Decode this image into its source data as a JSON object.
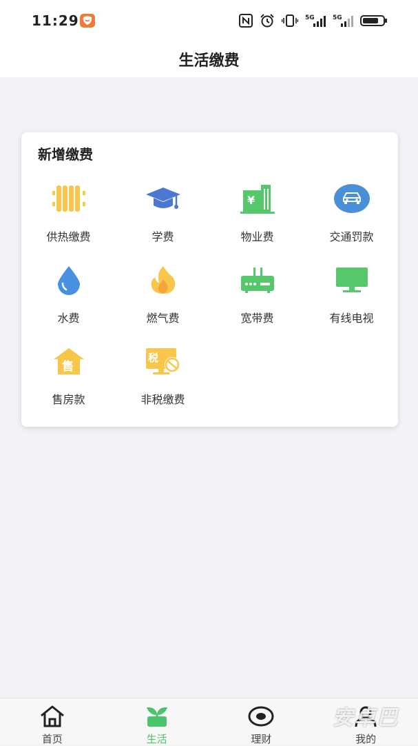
{
  "status": {
    "time": "11:29",
    "net1": "5G",
    "net2": "5G"
  },
  "header": {
    "title": "生活缴费"
  },
  "card": {
    "title": "新增缴费",
    "items": [
      {
        "label": "供热缴费",
        "icon": "radiator-icon",
        "color": "#f7c64b"
      },
      {
        "label": "学费",
        "icon": "graduation-cap-icon",
        "color": "#4a78d2"
      },
      {
        "label": "物业费",
        "icon": "building-yuan-icon",
        "color": "#57c76b"
      },
      {
        "label": "交通罚款",
        "icon": "car-icon",
        "color": "#4a90d9"
      },
      {
        "label": "水费",
        "icon": "water-drop-icon",
        "color": "#4a90e2"
      },
      {
        "label": "燃气费",
        "icon": "flame-icon",
        "color": "#f7c64b"
      },
      {
        "label": "宽带费",
        "icon": "router-icon",
        "color": "#57c76b"
      },
      {
        "label": "有线电视",
        "icon": "tv-icon",
        "color": "#57c76b"
      },
      {
        "label": "售房款",
        "icon": "house-sale-icon",
        "color": "#f7c64b"
      },
      {
        "label": "非税缴费",
        "icon": "tax-icon",
        "color": "#f7c64b"
      }
    ],
    "house_glyph": "售",
    "tax_glyph": "税"
  },
  "tabs": [
    {
      "label": "首页",
      "icon": "home-icon"
    },
    {
      "label": "生活",
      "icon": "sprout-icon",
      "active": true
    },
    {
      "label": "理财",
      "icon": "eye-icon"
    },
    {
      "label": "我的",
      "icon": "user-icon"
    }
  ],
  "watermark": "安卓巴"
}
